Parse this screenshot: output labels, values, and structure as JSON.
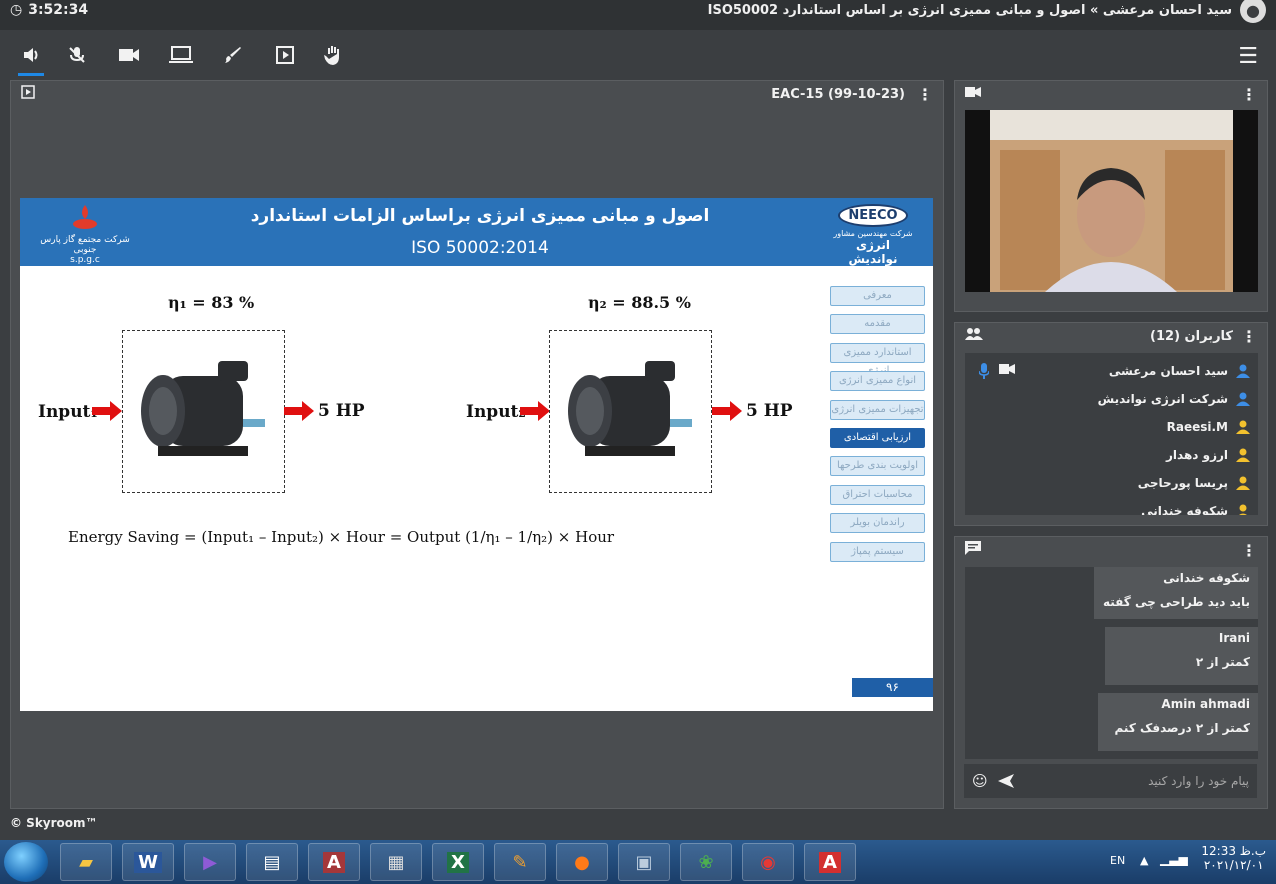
{
  "top": {
    "time": "3:52:34",
    "breadcrumb": "سید احسان مرعشی » اصول و مبانی ممیزی انرژی بر اساس استاندارد ISO50002"
  },
  "presentation": {
    "file_label": "EAC-15 (99-10-23)",
    "slide": {
      "title": "اصول و مبانی ممیزی انرژی براساس الزامات استاندارد",
      "subtitle": "ISO 50002:2014",
      "left_logo_text": "شرکت مجتمع گاز پارس جنوبی",
      "left_logo_abbr": "s.p.g.c",
      "right_logo_name": "NEECO",
      "right_logo_line1": "شرکت مهندسین مشاور",
      "right_logo_line2": "انرژی نواندیش",
      "nav": [
        "معرفی",
        "مقدمه",
        "استاندارد ممیزی انرژی",
        "انواع ممیزی انرژی",
        "تجهیزات ممیزی انرژی",
        "ارزیابی اقتصادی",
        "اولویت بندی طرحها",
        "محاسبات احتراق",
        "راندمان بویلر",
        "سیستم پمپاژ"
      ],
      "eta1": "η₁ = 83 %",
      "eta2": "η₂ = 88.5 %",
      "input1": "Input₁",
      "input2": "Input₂",
      "output1": "5 HP",
      "output2": "5 HP",
      "formula": "Energy Saving = (Input₁ – Input₂) × Hour = Output (1/η₁ – 1/η₂) × Hour",
      "page_number": "۹۶"
    }
  },
  "users": {
    "title": "کاربران (12)",
    "list": [
      {
        "name": "سید احسان مرعشی",
        "color": "#3d8ee6"
      },
      {
        "name": "شرکت انرژی نواندیش",
        "color": "#3d8ee6"
      },
      {
        "name": "Raeesi.M",
        "color": "#f2c12e"
      },
      {
        "name": "ارزو دهدار",
        "color": "#f2c12e"
      },
      {
        "name": "پریسا پورحاجی",
        "color": "#f2c12e"
      },
      {
        "name": "شکوفه خندانی",
        "color": "#f2c12e"
      }
    ]
  },
  "chat": {
    "messages": [
      {
        "name": "شکوفه خندانی",
        "text": "باید دید طراحی چی گفته"
      },
      {
        "name": "Irani",
        "text": "کمتر از ۲"
      },
      {
        "name": "Amin ahmadi",
        "text": "کمتر از ۲ درصدفک کنم"
      }
    ],
    "placeholder": "پیام خود را وارد کنید"
  },
  "brand": "© Skyroom™",
  "taskbar": {
    "lang": "EN",
    "time": "12:33 ب.ظ",
    "date": "۲۰۲۱/۱۲/۰۱",
    "apps": [
      "explorer",
      "word",
      "visual-studio",
      "notepad",
      "access",
      "fax",
      "excel",
      "paint",
      "firefox",
      "network",
      "colors",
      "record",
      "pdf"
    ]
  },
  "colors": {
    "accent": "#1e88e5",
    "slide_blue": "#2a72b8"
  }
}
